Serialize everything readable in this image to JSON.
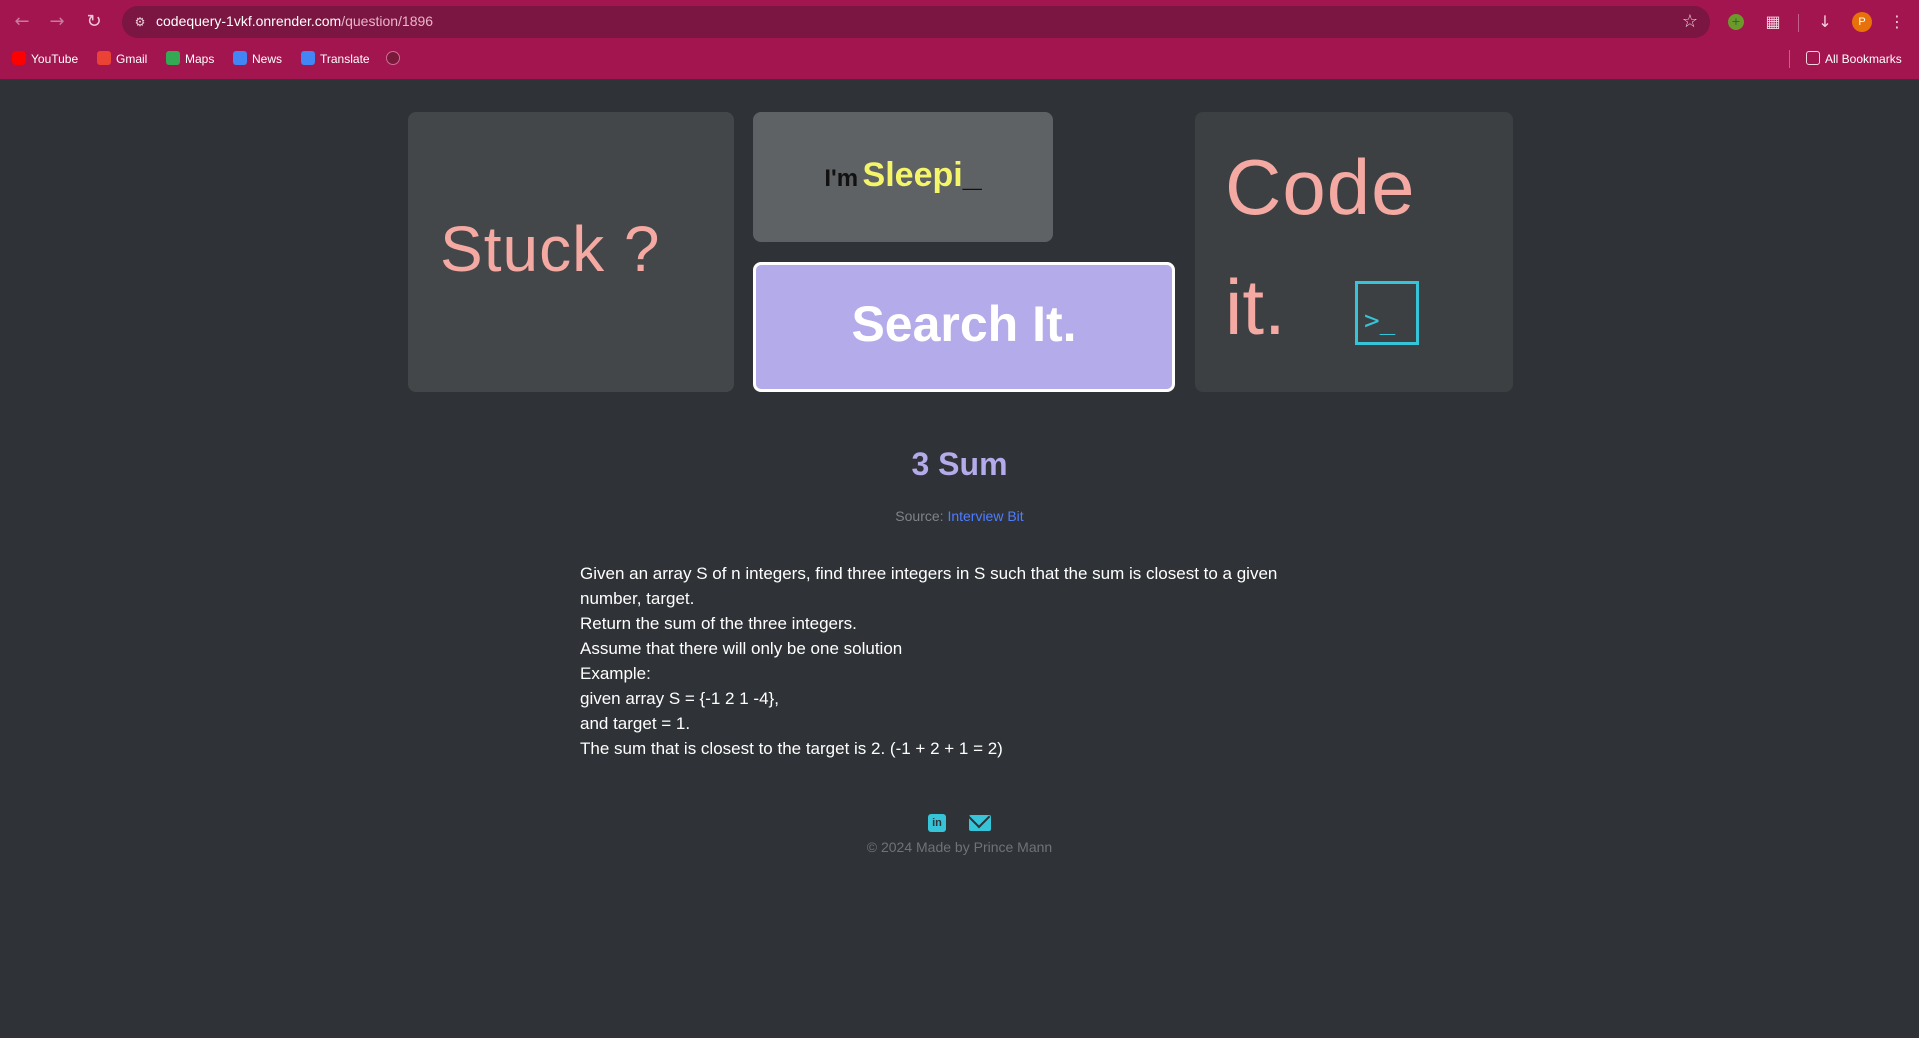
{
  "browser": {
    "url_host": "codequery-1vkf.onrender.com",
    "url_path": "/question/1896",
    "icons": {
      "back": "arrow-left-icon",
      "forward": "arrow-right-icon",
      "reload": "reload-icon",
      "site_info": "tune-icon",
      "bookmark_star": "star-icon",
      "extension": "puzzle-icon",
      "download": "download-icon"
    },
    "profile_initial": "P",
    "bookmarks": [
      {
        "label": "YouTube",
        "color": "#ff0000"
      },
      {
        "label": "Gmail",
        "color": "#ea4335"
      },
      {
        "label": "Maps",
        "color": "#34a853"
      },
      {
        "label": "News",
        "color": "#4285f4"
      },
      {
        "label": "Translate",
        "color": "#4285f4"
      }
    ],
    "all_bookmarks": "All Bookmarks"
  },
  "hero": {
    "stuck": "Stuck ?",
    "sleep_prefix": "I'm",
    "sleep_word": "Sleepi",
    "sleep_cursor": "_",
    "search": "Search It.",
    "code_line1": "Code",
    "code_line2": "it.",
    "terminal_prompt": ">_"
  },
  "question": {
    "title": "3 Sum",
    "source_label": "Source:",
    "source_link": "Interview Bit",
    "lines": [
      "Given an array S of n integers, find three integers in S such that the sum is closest to a given number, target.",
      "Return the sum of the three integers.",
      "Assume that there will only be one solution",
      "Example:",
      "given array S = {-1 2 1 -4},",
      "and target = 1.",
      "The sum that is closest to the target is 2. (-1 + 2 + 1 = 2)"
    ]
  },
  "footer": {
    "linkedin_glyph": "in",
    "copyright": "© 2024 Made by Prince Mann"
  },
  "colors": {
    "chrome": "#a3154f",
    "page_bg": "#2f3236",
    "accent_pink": "#f4a9a2",
    "accent_lavender": "#b4abea",
    "accent_cyan": "#36c4d8",
    "link_blue": "#4f7dff"
  }
}
